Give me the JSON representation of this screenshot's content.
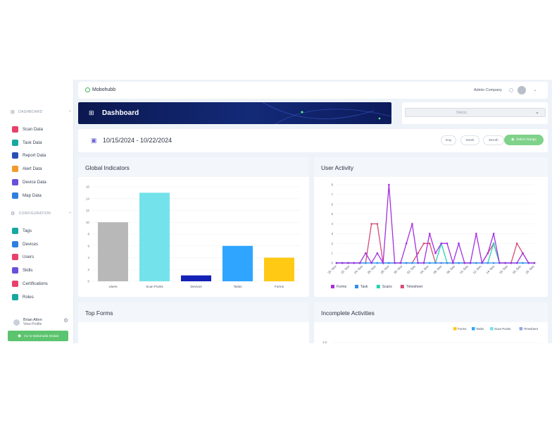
{
  "app": {
    "brand": "Mobohubb",
    "company": "Admin Company"
  },
  "sidebar": {
    "dashboard_section": "DASHBOARD",
    "dashboard_items": [
      {
        "label": "Scan Data",
        "color": "#e8416b"
      },
      {
        "label": "Task Data",
        "color": "#18a7a0"
      },
      {
        "label": "Report Data",
        "color": "#2a4fb8"
      },
      {
        "label": "Alert Data",
        "color": "#f39a2a"
      },
      {
        "label": "Device Data",
        "color": "#6a4fd9"
      },
      {
        "label": "Map Data",
        "color": "#2f7fe0"
      }
    ],
    "config_section": "CONFIGURATION",
    "config_items": [
      {
        "label": "Tags",
        "color": "#18a7a0"
      },
      {
        "label": "Devices",
        "color": "#2f7fe0"
      },
      {
        "label": "Users",
        "color": "#e8416b"
      },
      {
        "label": "Skills",
        "color": "#6a4fd9"
      },
      {
        "label": "Certifications",
        "color": "#e8416b"
      },
      {
        "label": "Roles",
        "color": "#18a7a0"
      }
    ],
    "user": {
      "name": "Brian Allen",
      "link": "View Profile"
    },
    "bottom_button": "Go to Mobohubb Global"
  },
  "banner": {
    "title": "Dashboard"
  },
  "site_select": {
    "placeholder": "Site(s)"
  },
  "datebar": {
    "range": "10/15/2024 - 10/22/2024",
    "day": "Day",
    "week": "Week",
    "month": "Month",
    "select_range": "Select Range"
  },
  "cards": {
    "global_indicators": "Global Indicators",
    "user_activity": "User Activity",
    "top_forms": "Top Forms",
    "incomplete_activities": "Incomplete Activities"
  },
  "chart_data": [
    {
      "type": "bar",
      "title": "Global Indicators",
      "categories": [
        "Users",
        "Scan Points",
        "Devices",
        "Tasks",
        "Forms"
      ],
      "values": [
        10,
        15,
        1,
        6,
        4
      ],
      "colors": [
        "#b8b8b8",
        "#74e2ea",
        "#1322b5",
        "#2fa5ff",
        "#ffc914"
      ],
      "ylim": [
        0,
        16
      ],
      "yticks": [
        "0",
        "2",
        "4",
        "6",
        "8",
        "10",
        "12",
        "14",
        "16"
      ],
      "grid": true
    },
    {
      "type": "line",
      "title": "User Activity",
      "x": [
        "20. Nov",
        "22. Nov",
        "24. Nov",
        "26. Nov",
        "28. Nov",
        "30. Nov",
        "02. Dec",
        "04. Dec",
        "06. Dec",
        "08. Dec",
        "10. Dec",
        "12. Dec",
        "14. Dec",
        "16. Dec",
        "18. Dec",
        "20. Dec"
      ],
      "ylim": [
        0,
        8
      ],
      "yticks": [
        "0",
        "1",
        "2",
        "3",
        "4",
        "5",
        "6",
        "7",
        "8"
      ],
      "legend_position": "bottom-left",
      "series": [
        {
          "name": "Forms",
          "color": "#a32fe3",
          "values": [
            0,
            0,
            0,
            0,
            0,
            1,
            0,
            1,
            0,
            8,
            0,
            0,
            2,
            4,
            0,
            0,
            3,
            1,
            2,
            2,
            0,
            2,
            0,
            0,
            3,
            0,
            1,
            3,
            0,
            0,
            0,
            0,
            1,
            0,
            0
          ]
        },
        {
          "name": "Task",
          "color": "#2f8cf5",
          "values": [
            0,
            0,
            0,
            0,
            0,
            0,
            0,
            0,
            0,
            0,
            0,
            0,
            0,
            0,
            0,
            0,
            0,
            0,
            0,
            0,
            0,
            0,
            0,
            0,
            0,
            0,
            0,
            0,
            0,
            0,
            0,
            0,
            0,
            0,
            0
          ]
        },
        {
          "name": "Scans",
          "color": "#25d4b0",
          "values": [
            0,
            0,
            0,
            0,
            0,
            0,
            0,
            0,
            0,
            0,
            0,
            0,
            0,
            0,
            0,
            0,
            0,
            0,
            2,
            0,
            0,
            0,
            0,
            0,
            0,
            0,
            0,
            2,
            0,
            0,
            0,
            0,
            0,
            0,
            0
          ]
        },
        {
          "name": "Timesheet",
          "color": "#d64b74",
          "values": [
            0,
            0,
            0,
            0,
            0,
            0,
            4,
            4,
            0,
            0,
            0,
            0,
            0,
            0,
            1,
            2,
            2,
            0,
            0,
            0,
            0,
            0,
            0,
            0,
            0,
            0,
            1,
            2,
            0,
            0,
            0,
            2,
            1,
            0,
            0
          ]
        }
      ]
    },
    {
      "type": "bar",
      "title": "Incomplete Activities",
      "series": [
        {
          "name": "Forms",
          "color": "#ffc914"
        },
        {
          "name": "Tasks",
          "color": "#2fa5ff"
        },
        {
          "name": "Scan Points",
          "color": "#74e2ea"
        },
        {
          "name": "Timesheet",
          "color": "#8ea7e6"
        }
      ],
      "legend_position": "top-right",
      "yticks": [
        "1.0"
      ]
    }
  ]
}
